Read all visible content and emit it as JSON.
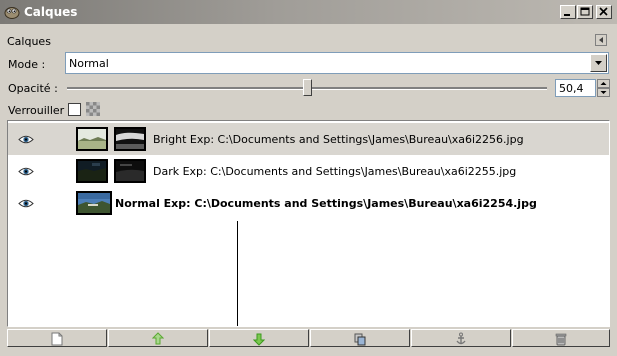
{
  "window": {
    "title": "Calques"
  },
  "panel": {
    "label": "Calques"
  },
  "mode": {
    "label": "Mode :",
    "value": "Normal"
  },
  "opacity": {
    "label": "Opacité :",
    "value": "50,4",
    "level_percent": 50.4
  },
  "lock": {
    "label": "Verrouiller :"
  },
  "layers": [
    {
      "name": "Bright Exp: C:\\Documents and Settings\\James\\Bureau\\xa6i2256.jpg",
      "selected": true,
      "bold": false,
      "has_mask": true
    },
    {
      "name": "Dark Exp: C:\\Documents and Settings\\James\\Bureau\\xa6i2255.jpg",
      "selected": false,
      "bold": false,
      "has_mask": true
    },
    {
      "name": "Normal Exp: C:\\Documents and Settings\\James\\Bureau\\xa6i2254.jpg",
      "selected": false,
      "bold": true,
      "has_mask": false
    }
  ],
  "toolbar": [
    {
      "icon": "new-layer-icon"
    },
    {
      "icon": "raise-layer-icon"
    },
    {
      "icon": "lower-layer-icon"
    },
    {
      "icon": "duplicate-layer-icon"
    },
    {
      "icon": "anchor-layer-icon"
    },
    {
      "icon": "delete-layer-icon"
    }
  ],
  "colors": {
    "selected_row": "#d9d6d0",
    "raise_arrow": "#5aa832",
    "lower_arrow": "#3c9a1e"
  }
}
